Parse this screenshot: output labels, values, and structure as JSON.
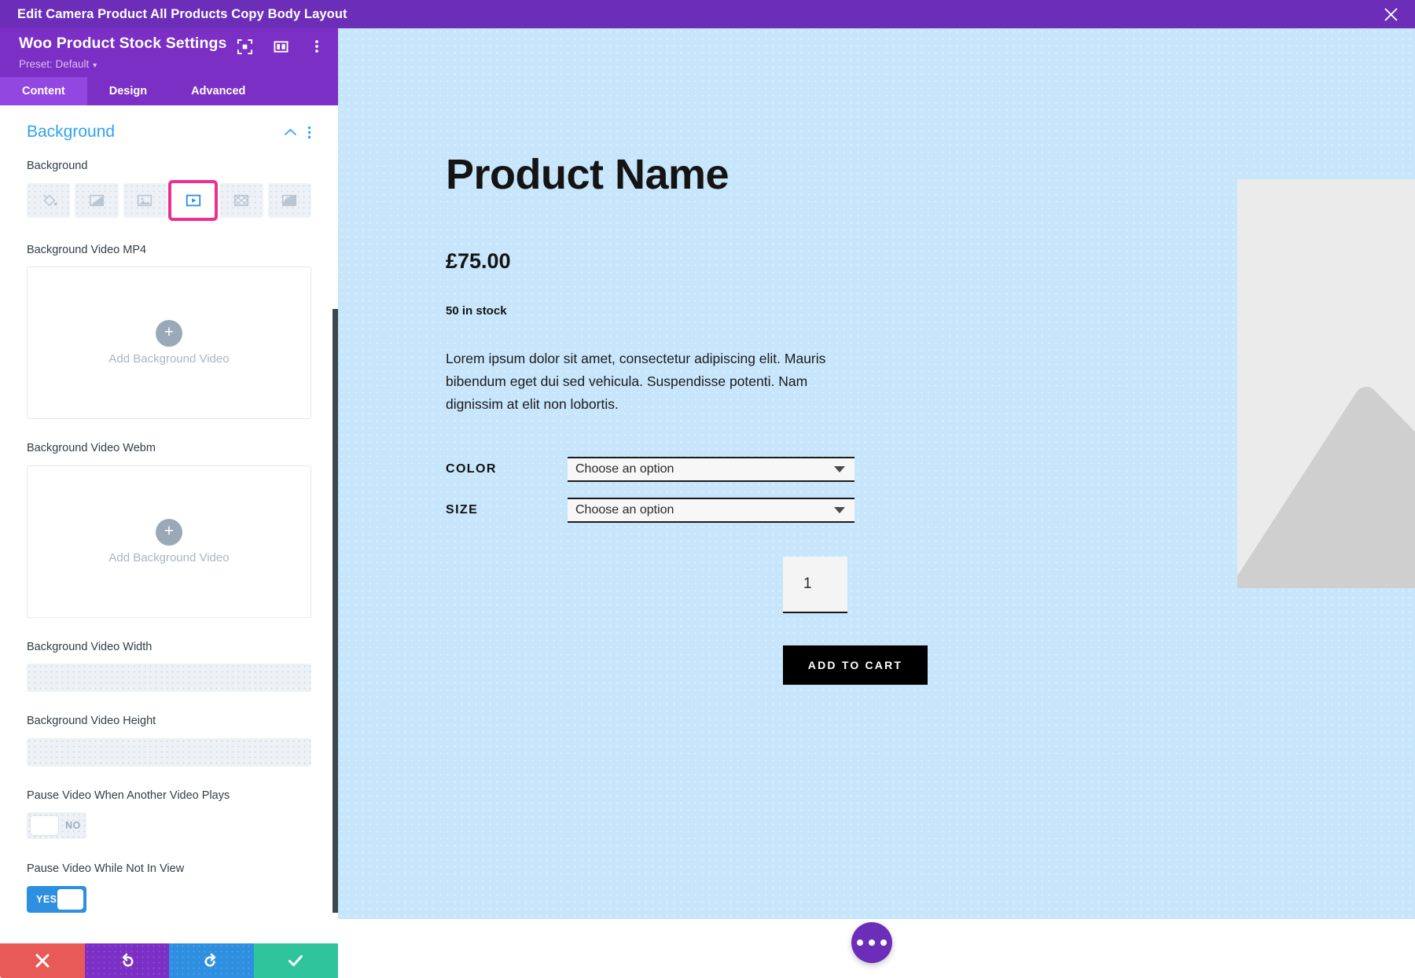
{
  "titlebar": {
    "title": "Edit Camera Product All Products Copy Body Layout",
    "close_icon": "close-icon"
  },
  "panel": {
    "module_name": "Woo Product Stock Settings",
    "preset_label": "Preset: Default",
    "head_icons": [
      "focus-target-icon",
      "layout-columns-icon",
      "kebab-menu-icon"
    ],
    "tabs": [
      {
        "label": "Content",
        "active": true
      },
      {
        "label": "Design",
        "active": false
      },
      {
        "label": "Advanced",
        "active": false
      }
    ],
    "section": {
      "title": "Background",
      "collapse_icon": "chevron-up-icon",
      "more_icon": "kebab-menu-icon"
    },
    "fields": {
      "background_label": "Background",
      "bg_types": [
        {
          "name": "background-color",
          "selected": false
        },
        {
          "name": "background-gradient",
          "selected": false
        },
        {
          "name": "background-image",
          "selected": false
        },
        {
          "name": "background-video",
          "selected": true
        },
        {
          "name": "background-pattern",
          "selected": false
        },
        {
          "name": "background-mask",
          "selected": false
        }
      ],
      "mp4_label": "Background Video MP4",
      "mp4_upload_text": "Add Background Video",
      "webm_label": "Background Video Webm",
      "webm_upload_text": "Add Background Video",
      "width_label": "Background Video Width",
      "width_value": "",
      "height_label": "Background Video Height",
      "height_value": "",
      "pause_other_label": "Pause Video When Another Video Plays",
      "pause_other_value": "NO",
      "pause_notinview_label": "Pause Video While Not In View",
      "pause_notinview_value": "YES"
    },
    "actions": [
      {
        "name": "cancel",
        "icon": "close-x-icon",
        "color": "#e85a57"
      },
      {
        "name": "undo",
        "icon": "undo-arrow-icon",
        "color": "#7b2fc4"
      },
      {
        "name": "redo",
        "icon": "redo-arrow-icon",
        "color": "#2e8fe0"
      },
      {
        "name": "save",
        "icon": "check-icon",
        "color": "#2fc49b"
      }
    ]
  },
  "preview": {
    "background_color": "#c7e5fb",
    "product": {
      "name": "Product Name",
      "price": "£75.00",
      "stock": "50 in stock",
      "description": "Lorem ipsum dolor sit amet, consectetur adipiscing elit. Mauris bibendum eget dui sed vehicula. Suspendisse potenti. Nam dignissim at elit non lobortis.",
      "attributes": [
        {
          "label": "COLOR",
          "value": "Choose an option"
        },
        {
          "label": "SIZE",
          "value": "Choose an option"
        }
      ],
      "quantity": "1",
      "cart_button": "ADD TO CART",
      "image_placeholder": "image-placeholder-icon"
    },
    "fab_icon": "ellipsis-icon"
  }
}
